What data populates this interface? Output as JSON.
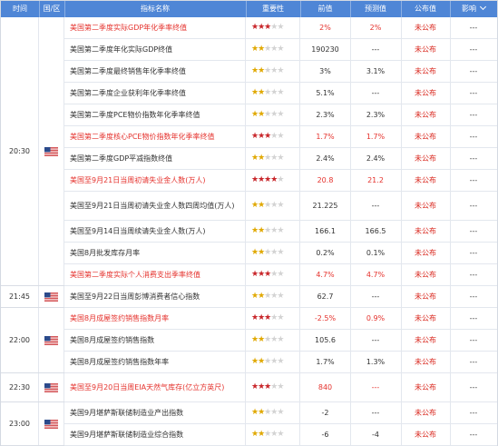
{
  "header": {
    "time": "时间",
    "country": "国/区",
    "name": "指标名称",
    "importance": "重要性",
    "previous": "前值",
    "forecast": "预测值",
    "actual": "公布值",
    "effect": "影响"
  },
  "colors": {
    "header_bg": "#4f86d6",
    "highlight_text": "#e5322d",
    "star_high": "#c8262a",
    "star_mid": "#e0a800"
  },
  "icons": {
    "flag": "us-flag-icon",
    "sort": "chevron-down-icon"
  },
  "groups": [
    {
      "time": "20:30",
      "rows": 12
    },
    {
      "time": "21:45",
      "rows": 1
    },
    {
      "time": "22:00",
      "rows": 3
    },
    {
      "time": "22:30",
      "rows": 1
    },
    {
      "time": "23:00",
      "rows": 2
    }
  ],
  "rows": [
    {
      "name": "美国第二季度实际GDP年化季率终值",
      "stars": 3,
      "previous": "2%",
      "forecast": "2%",
      "actual": "未公布",
      "effect": "---",
      "highlight": true
    },
    {
      "name": "美国第二季度年化实际GDP终值",
      "stars": 2,
      "previous": "190230",
      "forecast": "---",
      "actual": "未公布",
      "effect": "---",
      "highlight": false
    },
    {
      "name": "美国第二季度最终销售年化季率终值",
      "stars": 2,
      "previous": "3%",
      "forecast": "3.1%",
      "actual": "未公布",
      "effect": "---",
      "highlight": false
    },
    {
      "name": "美国第二季度企业获利年化季率终值",
      "stars": 2,
      "previous": "5.1%",
      "forecast": "---",
      "actual": "未公布",
      "effect": "---",
      "highlight": false
    },
    {
      "name": "美国第二季度PCE物价指数年化季率终值",
      "stars": 2,
      "previous": "2.3%",
      "forecast": "2.3%",
      "actual": "未公布",
      "effect": "---",
      "highlight": false
    },
    {
      "name": "美国第二季度核心PCE物价指数年化季率终值",
      "stars": 3,
      "previous": "1.7%",
      "forecast": "1.7%",
      "actual": "未公布",
      "effect": "---",
      "highlight": true
    },
    {
      "name": "美国第二季度GDP平减指数终值",
      "stars": 2,
      "previous": "2.4%",
      "forecast": "2.4%",
      "actual": "未公布",
      "effect": "---",
      "highlight": false
    },
    {
      "name": "美国至9月21日当周初请失业金人数(万人)",
      "stars": 4,
      "previous": "20.8",
      "forecast": "21.2",
      "actual": "未公布",
      "effect": "---",
      "highlight": true
    },
    {
      "name": "美国至9月21日当周初请失业金人数四周均值(万人)",
      "stars": 2,
      "previous": "21.225",
      "forecast": "---",
      "actual": "未公布",
      "effect": "---",
      "highlight": false
    },
    {
      "name": "美国至9月14日当周续请失业金人数(万人)",
      "stars": 2,
      "previous": "166.1",
      "forecast": "166.5",
      "actual": "未公布",
      "effect": "---",
      "highlight": false
    },
    {
      "name": "美国8月批发库存月率",
      "stars": 2,
      "previous": "0.2%",
      "forecast": "0.1%",
      "actual": "未公布",
      "effect": "---",
      "highlight": false
    },
    {
      "name": "美国第二季度实际个人消费支出季率终值",
      "stars": 3,
      "previous": "4.7%",
      "forecast": "4.7%",
      "actual": "未公布",
      "effect": "---",
      "highlight": true
    },
    {
      "name": "美国至9月22日当周彭博消费者信心指数",
      "stars": 2,
      "previous": "62.7",
      "forecast": "---",
      "actual": "未公布",
      "effect": "---",
      "highlight": false
    },
    {
      "name": "美国8月成屋签约销售指数月率",
      "stars": 3,
      "previous": "-2.5%",
      "forecast": "0.9%",
      "actual": "未公布",
      "effect": "---",
      "highlight": true
    },
    {
      "name": "美国8月成屋签约销售指数",
      "stars": 2,
      "previous": "105.6",
      "forecast": "---",
      "actual": "未公布",
      "effect": "---",
      "highlight": false
    },
    {
      "name": "美国8月成屋签约销售指数年率",
      "stars": 2,
      "previous": "1.7%",
      "forecast": "1.3%",
      "actual": "未公布",
      "effect": "---",
      "highlight": false
    },
    {
      "name": "美国至9月20日当周EIA天然气库存(亿立方英尺)",
      "stars": 3,
      "previous": "840",
      "forecast": "---",
      "actual": "未公布",
      "effect": "---",
      "highlight": true
    },
    {
      "name": "美国9月堪萨斯联储制造业产出指数",
      "stars": 2,
      "previous": "-2",
      "forecast": "---",
      "actual": "未公布",
      "effect": "---",
      "highlight": false
    },
    {
      "name": "美国9月堪萨斯联储制造业综合指数",
      "stars": 2,
      "previous": "-6",
      "forecast": "-4",
      "actual": "未公布",
      "effect": "---",
      "highlight": false
    }
  ]
}
